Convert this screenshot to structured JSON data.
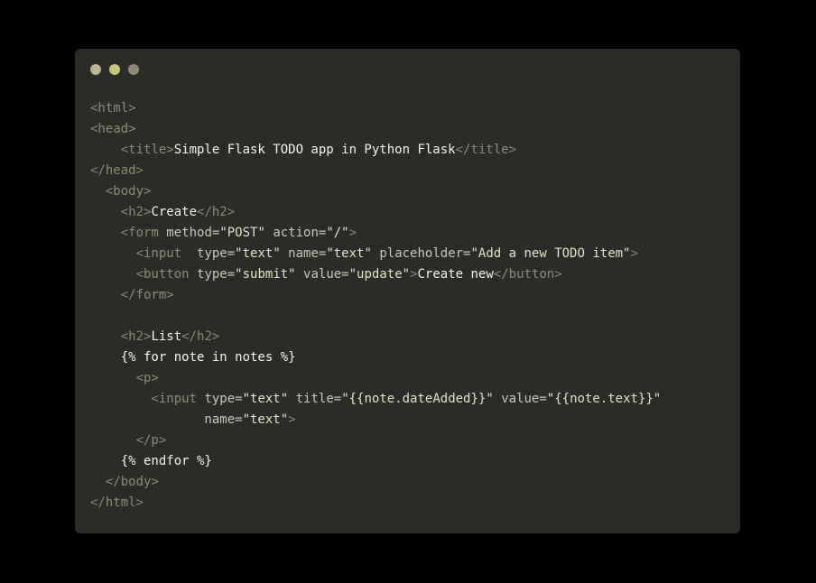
{
  "colors": {
    "page_background": "#000000",
    "window_background": "#2b2c27",
    "dot_1": "#b9b48f",
    "dot_2": "#c9c77c",
    "dot_3": "#8f8a78",
    "tag": "#8d8a76",
    "attribute": "#c9c7b6",
    "string": "#e4e1c8",
    "text": "#f4f3ec"
  },
  "window_controls": [
    "dot-icon",
    "dot-icon",
    "dot-icon"
  ],
  "code_lines": [
    [
      {
        "t": "<html>",
        "c": "tag"
      }
    ],
    [
      {
        "t": "<head>",
        "c": "tag"
      }
    ],
    [
      {
        "t": "    <title>",
        "c": "tag"
      },
      {
        "t": "Simple Flask TODO app in Python Flask",
        "c": "txt"
      },
      {
        "t": "</title>",
        "c": "tag"
      }
    ],
    [
      {
        "t": "</head>",
        "c": "tag"
      }
    ],
    [
      {
        "t": "  <body>",
        "c": "tag"
      }
    ],
    [
      {
        "t": "    <h2>",
        "c": "tag"
      },
      {
        "t": "Create",
        "c": "txt"
      },
      {
        "t": "</h2>",
        "c": "tag"
      }
    ],
    [
      {
        "t": "    <form ",
        "c": "tag"
      },
      {
        "t": "method=",
        "c": "attr"
      },
      {
        "t": "\"POST\"",
        "c": "str"
      },
      {
        "t": " action=",
        "c": "attr"
      },
      {
        "t": "\"/\"",
        "c": "str"
      },
      {
        "t": ">",
        "c": "tag"
      }
    ],
    [
      {
        "t": "      <input  ",
        "c": "tag"
      },
      {
        "t": "type=",
        "c": "attr"
      },
      {
        "t": "\"text\"",
        "c": "str"
      },
      {
        "t": " name=",
        "c": "attr"
      },
      {
        "t": "\"text\"",
        "c": "str"
      },
      {
        "t": " placeholder=",
        "c": "attr"
      },
      {
        "t": "\"Add a new TODO item\"",
        "c": "str"
      },
      {
        "t": ">",
        "c": "tag"
      }
    ],
    [
      {
        "t": "      <button ",
        "c": "tag"
      },
      {
        "t": "type=",
        "c": "attr"
      },
      {
        "t": "\"submit\"",
        "c": "str"
      },
      {
        "t": " value=",
        "c": "attr"
      },
      {
        "t": "\"update\"",
        "c": "str"
      },
      {
        "t": ">",
        "c": "tag"
      },
      {
        "t": "Create new",
        "c": "txt"
      },
      {
        "t": "</button>",
        "c": "tag"
      }
    ],
    [
      {
        "t": "    </form>",
        "c": "tag"
      }
    ],
    [],
    [
      {
        "t": "    <h2>",
        "c": "tag"
      },
      {
        "t": "List",
        "c": "txt"
      },
      {
        "t": "</h2>",
        "c": "tag"
      }
    ],
    [
      {
        "t": "    {% for note in notes %}",
        "c": "tpl"
      }
    ],
    [
      {
        "t": "      <p>",
        "c": "tag"
      }
    ],
    [
      {
        "t": "        <input ",
        "c": "tag"
      },
      {
        "t": "type=",
        "c": "attr"
      },
      {
        "t": "\"text\"",
        "c": "str"
      },
      {
        "t": " title=",
        "c": "attr"
      },
      {
        "t": "\"{{note.dateAdded}}\"",
        "c": "str"
      },
      {
        "t": " value=",
        "c": "attr"
      },
      {
        "t": "\"{{note.text}}\"",
        "c": "str"
      }
    ],
    [
      {
        "t": "               name=",
        "c": "attr"
      },
      {
        "t": "\"text\"",
        "c": "str"
      },
      {
        "t": ">",
        "c": "tag"
      }
    ],
    [
      {
        "t": "      </p>",
        "c": "tag"
      }
    ],
    [
      {
        "t": "    {% endfor %}",
        "c": "tpl"
      }
    ],
    [
      {
        "t": "  </body>",
        "c": "tag"
      }
    ],
    [
      {
        "t": "</html>",
        "c": "tag"
      }
    ]
  ]
}
